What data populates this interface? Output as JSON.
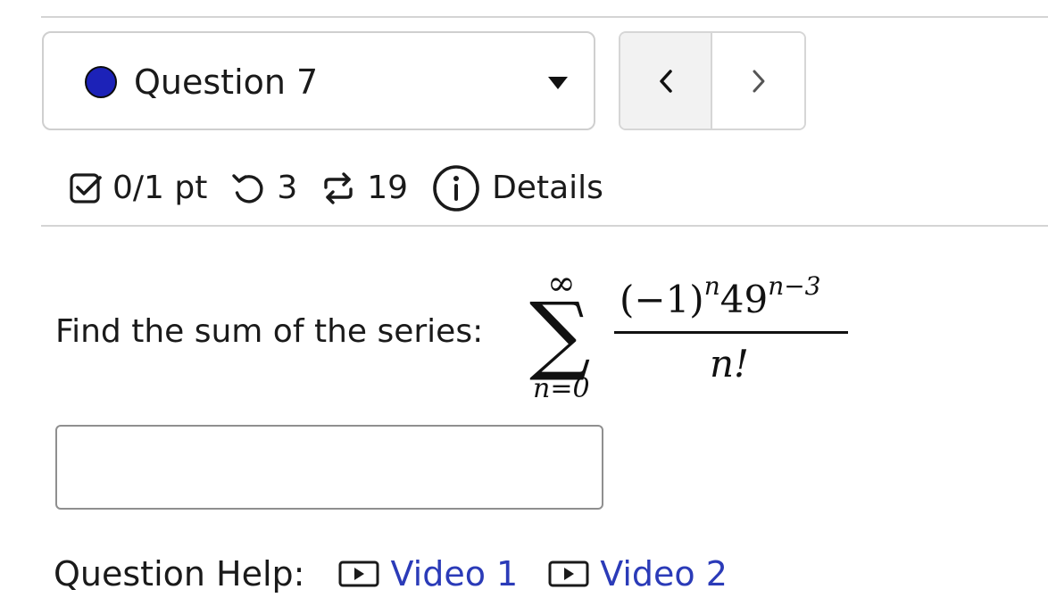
{
  "question_selector": {
    "label": "Question 7",
    "status_color": "#1c22b8"
  },
  "nav": {
    "prev_icon": "chevron-left-icon",
    "next_icon": "chevron-right-icon"
  },
  "status_bar": {
    "points": "0/1 pt",
    "retries": "3",
    "submissions": "19",
    "details_label": "Details"
  },
  "question": {
    "prompt": "Find the sum of the series:",
    "math": {
      "sum_upper": "∞",
      "sum_lower": "n=0",
      "numerator_base": "(−1)",
      "numerator_exp1": "n",
      "numerator_mid": "49",
      "numerator_exp2": "n−3",
      "denominator": "n!"
    }
  },
  "answer": {
    "value": "",
    "placeholder": ""
  },
  "help": {
    "label": "Question Help:",
    "links": [
      {
        "label": "Video 1",
        "icon": "play-video-icon"
      },
      {
        "label": "Video 2",
        "icon": "play-video-icon"
      }
    ]
  },
  "colors": {
    "link": "#2b3bb8",
    "border": "#cfcfcf"
  }
}
